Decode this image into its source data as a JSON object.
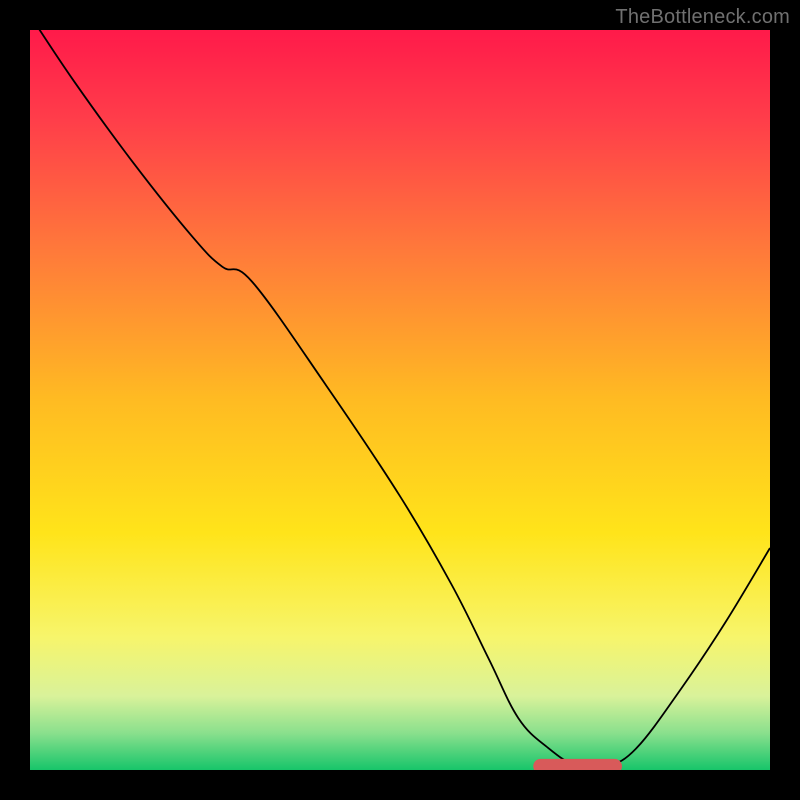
{
  "watermark": "TheBottleneck.com",
  "chart_data": {
    "type": "line",
    "title": "",
    "xlabel": "",
    "ylabel": "",
    "xlim": [
      0,
      100
    ],
    "ylim": [
      0,
      100
    ],
    "grid": false,
    "legend": false,
    "background_gradient_stops": [
      {
        "offset": 0.0,
        "color": "#ff1a4a"
      },
      {
        "offset": 0.12,
        "color": "#ff3d4a"
      },
      {
        "offset": 0.3,
        "color": "#ff7a3a"
      },
      {
        "offset": 0.5,
        "color": "#ffbb22"
      },
      {
        "offset": 0.68,
        "color": "#ffe41a"
      },
      {
        "offset": 0.82,
        "color": "#f7f56b"
      },
      {
        "offset": 0.9,
        "color": "#d9f29a"
      },
      {
        "offset": 0.95,
        "color": "#8ae08d"
      },
      {
        "offset": 1.0,
        "color": "#17c56a"
      }
    ],
    "series": [
      {
        "name": "bottleneck-curve",
        "color": "#000000",
        "x": [
          0,
          6,
          14,
          22,
          26,
          30,
          40,
          50,
          57,
          62,
          66,
          70,
          74,
          78,
          82,
          88,
          94,
          100
        ],
        "y": [
          102,
          93,
          82,
          72,
          68,
          66,
          52,
          37,
          25,
          15,
          7,
          3,
          0.5,
          0.5,
          3,
          11,
          20,
          30
        ]
      }
    ],
    "optimum_marker": {
      "color": "#d85a5a",
      "x_start": 68,
      "x_end": 80,
      "y": 0.5,
      "thickness": 2
    }
  }
}
